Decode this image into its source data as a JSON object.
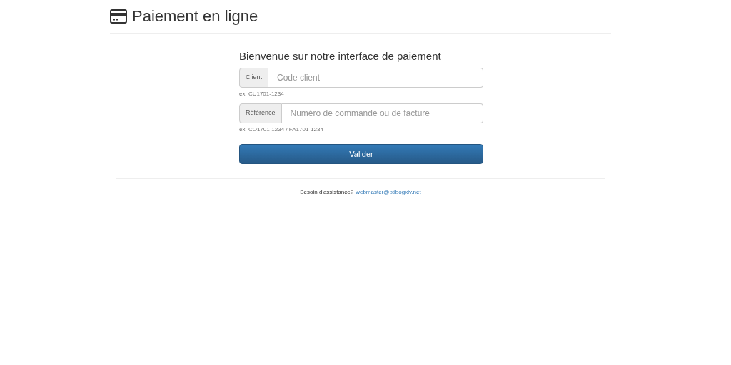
{
  "header": {
    "title": "Paiement en ligne"
  },
  "form": {
    "heading": "Bienvenue sur notre interface de paiement",
    "fields": [
      {
        "addon": "Client",
        "placeholder": "Code client",
        "help": "ex: CU1701-1234"
      },
      {
        "addon": "Référence",
        "placeholder": "Numéro de commande ou de facture",
        "help": "ex: CO1701-1234 / FA1701-1234"
      }
    ],
    "submit": "Valider"
  },
  "footer": {
    "text": "Besoin d'assistance?",
    "link": "webmaster@ptibogxiv.net"
  }
}
